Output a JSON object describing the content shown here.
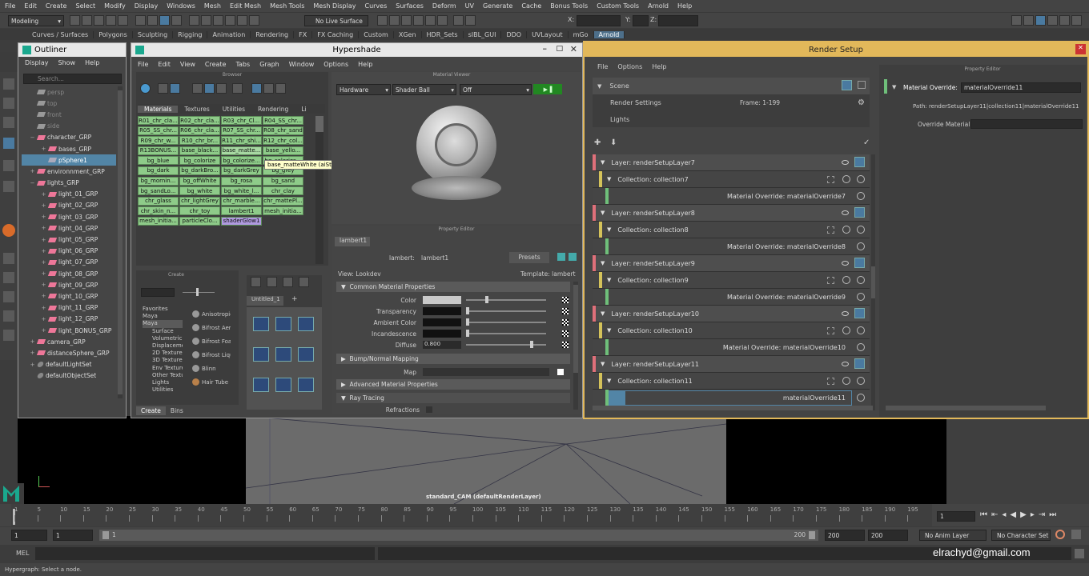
{
  "menubar": [
    "File",
    "Edit",
    "Create",
    "Select",
    "Modify",
    "Display",
    "Windows",
    "Mesh",
    "Edit Mesh",
    "Mesh Tools",
    "Mesh Display",
    "Curves",
    "Surfaces",
    "Deform",
    "UV",
    "Generate",
    "Cache",
    "Bonus Tools",
    "Custom Tools",
    "Arnold",
    "Help"
  ],
  "statusline": {
    "mode": "Modeling",
    "live_surface": "No Live Surface",
    "x_label": "X:",
    "y_label": "Y:",
    "z_label": "Z:"
  },
  "shelf_tabs": [
    "Curves / Surfaces",
    "Polygons",
    "Sculpting",
    "Rigging",
    "Animation",
    "Rendering",
    "FX",
    "FX Caching",
    "Custom",
    "XGen",
    "HDR_Sets",
    "sIBL_GUI",
    "DDO",
    "UVLayout",
    "mGo",
    "Arnold"
  ],
  "shelf_active": "Arnold",
  "outliner": {
    "title": "Outliner",
    "menu": [
      "Display",
      "Show",
      "Help"
    ],
    "search_placeholder": "Search...",
    "items": [
      {
        "label": "persp",
        "indent": 1,
        "dim": true,
        "pm": ""
      },
      {
        "label": "top",
        "indent": 1,
        "dim": true,
        "pm": ""
      },
      {
        "label": "front",
        "indent": 1,
        "dim": true,
        "pm": ""
      },
      {
        "label": "side",
        "indent": 1,
        "dim": true,
        "pm": ""
      },
      {
        "label": "character_GRP",
        "indent": 1,
        "dim": false,
        "pm": "−"
      },
      {
        "label": "bases_GRP",
        "indent": 2,
        "dim": false,
        "pm": "+"
      },
      {
        "label": "pSphere1",
        "indent": 2,
        "dim": false,
        "pm": "",
        "sel": true
      },
      {
        "label": "environnment_GRP",
        "indent": 1,
        "dim": false,
        "pm": "+"
      },
      {
        "label": "lights_GRP",
        "indent": 1,
        "dim": false,
        "pm": "−"
      },
      {
        "label": "light_01_GRP",
        "indent": 2,
        "dim": false,
        "pm": "+"
      },
      {
        "label": "light_02_GRP",
        "indent": 2,
        "dim": false,
        "pm": "+"
      },
      {
        "label": "light_03_GRP",
        "indent": 2,
        "dim": false,
        "pm": "+"
      },
      {
        "label": "light_04_GRP",
        "indent": 2,
        "dim": false,
        "pm": "+"
      },
      {
        "label": "light_05_GRP",
        "indent": 2,
        "dim": false,
        "pm": "+"
      },
      {
        "label": "light_06_GRP",
        "indent": 2,
        "dim": false,
        "pm": "+"
      },
      {
        "label": "light_07_GRP",
        "indent": 2,
        "dim": false,
        "pm": "+"
      },
      {
        "label": "light_08_GRP",
        "indent": 2,
        "dim": false,
        "pm": "+"
      },
      {
        "label": "light_09_GRP",
        "indent": 2,
        "dim": false,
        "pm": "+"
      },
      {
        "label": "light_10_GRP",
        "indent": 2,
        "dim": false,
        "pm": "+"
      },
      {
        "label": "light_11_GRP",
        "indent": 2,
        "dim": false,
        "pm": "+"
      },
      {
        "label": "light_12_GRP",
        "indent": 2,
        "dim": false,
        "pm": "+"
      },
      {
        "label": "light_BONUS_GRP",
        "indent": 2,
        "dim": false,
        "pm": "+"
      },
      {
        "label": "camera_GRP",
        "indent": 1,
        "dim": false,
        "pm": "+"
      },
      {
        "label": "distanceSphere_GRP",
        "indent": 1,
        "dim": false,
        "pm": "+"
      },
      {
        "label": "defaultLightSet",
        "indent": 1,
        "dim": false,
        "pm": "+"
      },
      {
        "label": "defaultObjectSet",
        "indent": 1,
        "dim": false,
        "pm": ""
      }
    ]
  },
  "hypershade": {
    "title": "Hypershade",
    "menu": [
      "File",
      "Edit",
      "View",
      "Create",
      "Tabs",
      "Graph",
      "Window",
      "Options",
      "Help"
    ],
    "browser_label": "Browser",
    "material_viewer_label": "Material Viewer",
    "browser_tabs": [
      "Materials",
      "Textures",
      "Utilities",
      "Rendering",
      "Li"
    ],
    "materials": [
      "R01_chr_cla...",
      "R02_chr_cla...",
      "R03_chr_Cl...",
      "R04_SS_chr...",
      "R05_SS_chr...",
      "R06_chr_cla...",
      "R07_SS_chr...",
      "R08_chr_sand",
      "R09_chr_w...",
      "R10_chr_br...",
      "R11_chr_shi...",
      "R12_chr_col...",
      "R13BONUS...",
      "base_black...",
      "base_matte...",
      "base_yello...",
      "bg_blue",
      "bg_colorize",
      "bg_colorize...",
      "bg_colorize...",
      "bg_dark",
      "bg_darkBro...",
      "bg_darkGrey",
      "bg_grey",
      "bg_mornin...",
      "bg_offWhite",
      "bg_rosa",
      "bg_sand",
      "bg_sandLo...",
      "bg_white",
      "bg_white_l...",
      "chr_clay",
      "chr_glass",
      "chr_lightGrey",
      "chr_marble...",
      "chr_mattePl...",
      "chr_skin_n...",
      "chr_toy",
      "lambert1",
      "mesh_initia...",
      "mesh_initia...",
      "particleClo...",
      "shaderGlow1"
    ],
    "tooltip": "base_matteWhite (aiStandard)",
    "viewer": {
      "renderer": "Hardware",
      "shape": "Shader Ball",
      "option": "Off"
    },
    "create_label": "Create",
    "create_tree": [
      "Favorites",
      "Maya",
      "Maya",
      "Surface",
      "Volumetric",
      "Displacement",
      "2D Textures",
      "3D Textures",
      "Env Textures",
      "Other Textures",
      "Lights",
      "Utilities"
    ],
    "create_list": [
      "Anisotropic",
      "Bifrost Aero",
      "Bifrost Foam",
      "Bifrost Liquid",
      "Blinn",
      "Hair Tube"
    ],
    "bottom_tabs": [
      "Create",
      "Bins"
    ],
    "graph_tab": "Untitled_1",
    "property_editor_label": "Property Editor",
    "prop": {
      "tab": "lambert1",
      "node_label": "lambert:",
      "node_name": "lambert1",
      "presets": "Presets",
      "view": "View: Lookdev",
      "template": "Template: lambert",
      "common": "Common Material Properties",
      "attrs": [
        "Color",
        "Transparency",
        "Ambient Color",
        "Incandescence",
        "Diffuse"
      ],
      "diffuse_value": "0.800",
      "color_fill": 0.24,
      "diffuse_fill": 0.8,
      "bump": "Bump/Normal Mapping",
      "map": "Map",
      "advanced": "Advanced Material Properties",
      "raytracing": "Ray Tracing",
      "refractions": "Refractions"
    }
  },
  "render_setup": {
    "title": "Render Setup",
    "menu": [
      "File",
      "Options",
      "Help"
    ],
    "scene": "Scene",
    "render_settings": "Render Settings",
    "frame": "Frame: 1-199",
    "lights": "Lights",
    "property_editor_label": "Property Editor",
    "override_label": "Material Override:",
    "override_value": "materialOverride11",
    "path": "Path: renderSetupLayer11|collection11|materialOverride11",
    "override_material": "Override Material",
    "layers": [
      {
        "layer": "Layer:  renderSetupLayer7",
        "collection": "Collection:  collection7",
        "override": "Material Override:  materialOverride7"
      },
      {
        "layer": "Layer:  renderSetupLayer8",
        "collection": "Collection:  collection8",
        "override": "Material Override:  materialOverride8"
      },
      {
        "layer": "Layer:  renderSetupLayer9",
        "collection": "Collection:  collection9",
        "override": "Material Override:  materialOverride9"
      },
      {
        "layer": "Layer:  renderSetupLayer10",
        "collection": "Collection:  collection10",
        "override": "Material Override:  materialOverride10"
      },
      {
        "layer": "Layer:  renderSetupLayer11",
        "collection": "Collection:  collection11",
        "override": "materialOverride11"
      }
    ]
  },
  "viewport": {
    "camera_label": "standard_CAM (defaultRenderLayer)"
  },
  "timeline": {
    "ticks": [
      "1",
      "5",
      "10",
      "15",
      "20",
      "25",
      "30",
      "35",
      "40",
      "45",
      "50",
      "55",
      "60",
      "65",
      "70",
      "75",
      "80",
      "85",
      "90",
      "95",
      "100",
      "105",
      "110",
      "115",
      "120",
      "125",
      "130",
      "135",
      "140",
      "145",
      "150",
      "155",
      "160",
      "165",
      "170",
      "175",
      "180",
      "185",
      "190",
      "195"
    ],
    "current_frame": "1"
  },
  "range": {
    "start1": "1",
    "start2": "1",
    "range_start": "1",
    "range_end": "200",
    "end1": "200",
    "end2": "200",
    "anim_layer": "No Anim Layer",
    "char_set": "No Character Set"
  },
  "cmdline": {
    "label": "MEL",
    "email": "elrachyd@gmail.com"
  },
  "helpline": "Hypergraph: Select a node.",
  "colors": {
    "accent": "#5285a6",
    "material_green": "#8ecb89",
    "layer_bar": "#e0707a",
    "collection_bar": "#d4c25a",
    "override_bar": "#6fbf7a",
    "render_setup_border": "#e2b85a"
  }
}
